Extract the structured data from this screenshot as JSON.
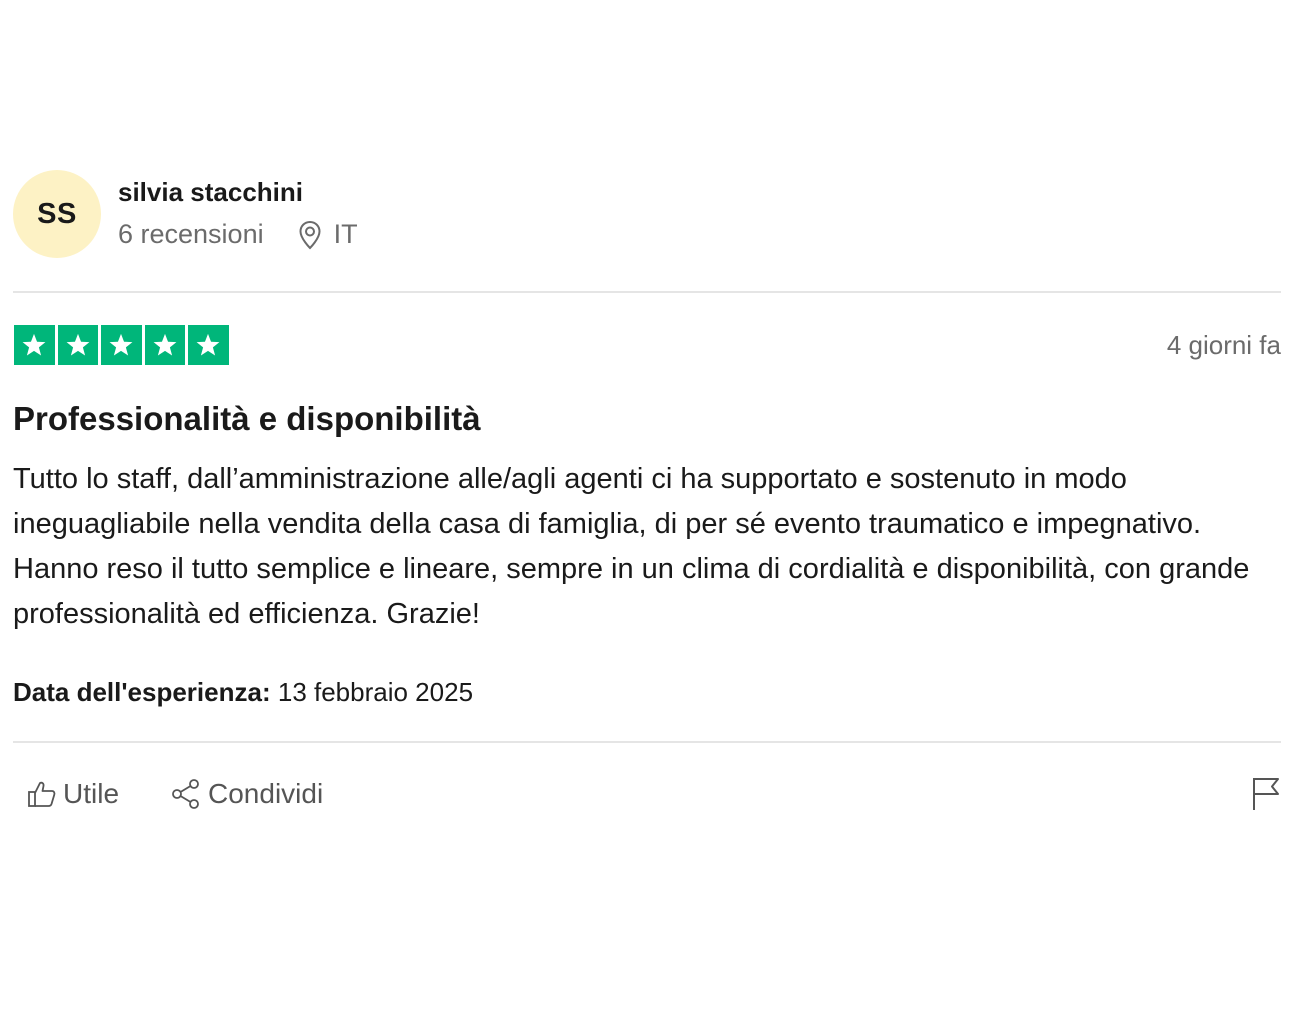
{
  "reviewer": {
    "initials": "SS",
    "name": "silvia stacchini",
    "review_count": "6 recensioni",
    "country": "IT"
  },
  "review": {
    "rating": 5,
    "max_rating": 5,
    "star_color": "#00b67a",
    "date_ago": "4 giorni fa",
    "title": "Professionalità e disponibilità",
    "body": [
      "Tutto lo staff, dall’amministrazione alle/agli agenti ci ha supportato e sostenuto in modo ineguagliabile nella vendita della casa di famiglia, di per sé evento traumatico e impegnativo.",
      "Hanno reso il tutto semplice e lineare, sempre in un clima di cordialità e disponibilità, con grande professionalità ed efficienza. Grazie!"
    ],
    "experience_label": "Data dell'esperienza:",
    "experience_date": "13 febbraio 2025"
  },
  "actions": {
    "useful_label": "Utile",
    "share_label": "Condividi"
  },
  "icons": {
    "location": "location-pin-icon",
    "useful": "thumbs-up-icon",
    "share": "share-icon",
    "report": "flag-icon",
    "star": "star-icon"
  }
}
